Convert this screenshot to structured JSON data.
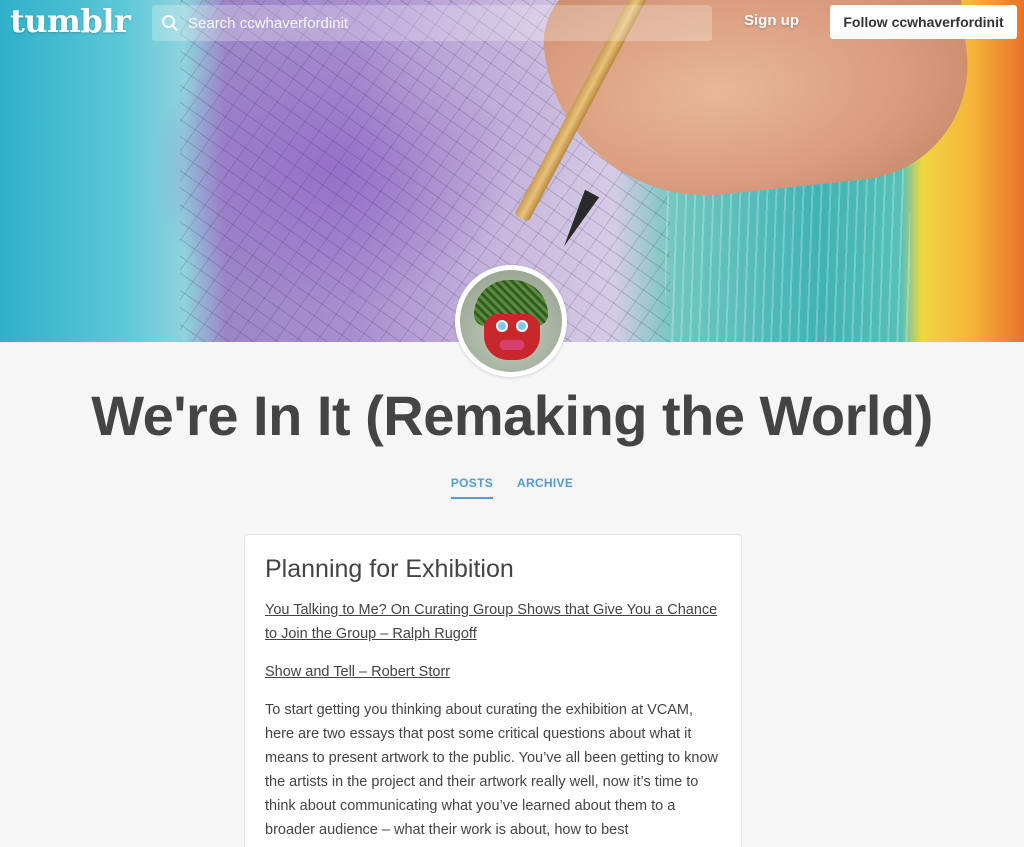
{
  "header": {
    "logo": "tumblr",
    "search_placeholder": "Search ccwhaverfordinit",
    "signup_label": "Sign up",
    "follow_label": "Follow ccwhaverfordinit"
  },
  "blog": {
    "title": "We're In It (Remaking the World)",
    "tabs": [
      {
        "label": "POSTS",
        "active": true
      },
      {
        "label": "ARCHIVE",
        "active": false
      }
    ]
  },
  "post": {
    "title": "Planning for Exhibition",
    "links": [
      "You Talking to Me? On Curating Group Shows that Give You a Chance to Join the Group – Ralph Rugoff",
      "Show and Tell – Robert Storr"
    ],
    "body": "To start getting you thinking about curating the exhibition at VCAM, here are two essays that post some critical questions about what it means to present artwork to the public. You’ve all been getting to know the artists in the project and their artwork really well, now it’s time to think about communicating what you’ve learned about them to a broader audience – what their work is about, how to best"
  },
  "colors": {
    "accent": "#529ecc",
    "title_text": "#444444",
    "page_bg": "#f6f6f6"
  }
}
